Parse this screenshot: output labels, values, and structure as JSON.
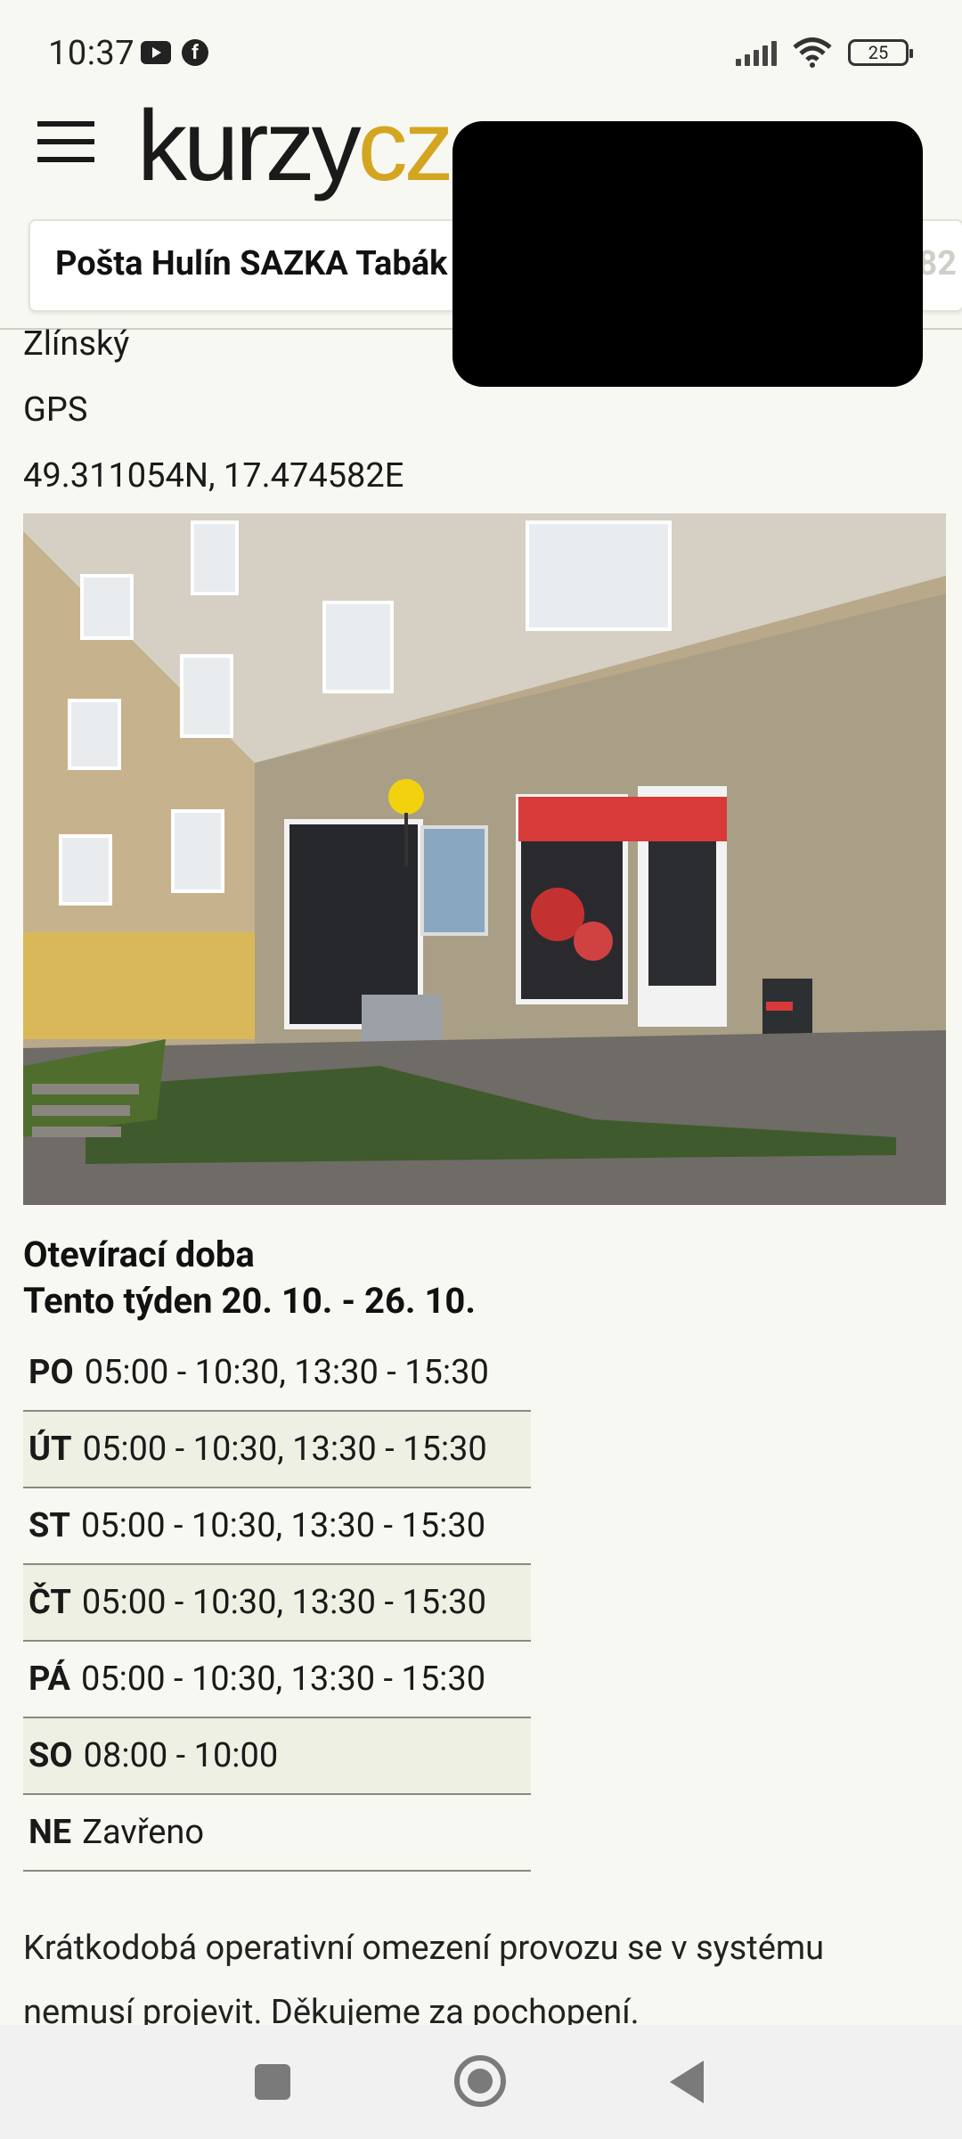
{
  "status_bar": {
    "time": "10:37",
    "battery": "25",
    "icons": [
      "youtube-icon",
      "facebook-icon",
      "signal-icon",
      "wifi-icon",
      "battery-icon"
    ]
  },
  "header": {
    "logo_dark": "kurzy",
    "logo_accent": "cz",
    "accent_color": "#d4a520"
  },
  "search": {
    "value": "Pošta Hulín SAZKA Tabák",
    "overflow_tail": "82"
  },
  "details": {
    "region": "Zlínský",
    "gps_label": "GPS",
    "gps_value": "49.311054N, 17.474582E"
  },
  "hours": {
    "title": "Otevírací doba",
    "week": "Tento týden 20. 10. - 26. 10.",
    "rows": [
      {
        "day": "PO",
        "time": "05:00 - 10:30, 13:30 - 15:30"
      },
      {
        "day": "ÚT",
        "time": "05:00 - 10:30, 13:30 - 15:30"
      },
      {
        "day": "ST",
        "time": "05:00 - 10:30, 13:30 - 15:30"
      },
      {
        "day": "ČT",
        "time": "05:00 - 10:30, 13:30 - 15:30"
      },
      {
        "day": "PÁ",
        "time": "05:00 - 10:30, 13:30 - 15:30"
      },
      {
        "day": "SO",
        "time": "08:00 - 10:00"
      },
      {
        "day": "NE",
        "time": "Zavřeno"
      }
    ]
  },
  "notice": "Krátkodobá operativní omezení provozu se v systému nemusí projevit. Děkujeme za pochopení."
}
